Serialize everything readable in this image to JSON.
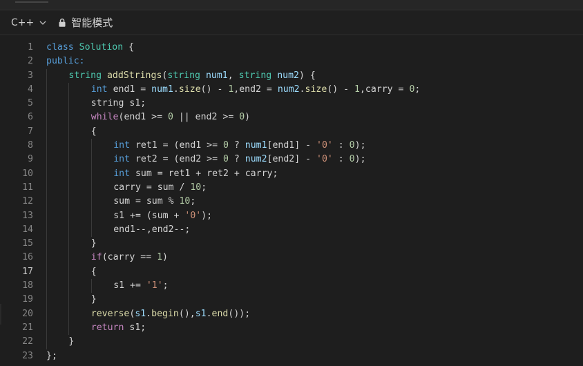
{
  "toolbar": {
    "language": "C++",
    "mode_label": "智能模式"
  },
  "colors": {
    "background": "#1e1e1e",
    "keyword": "#569cd6",
    "class": "#4ec9b0",
    "function": "#dcdcaa",
    "control": "#c586c0",
    "number": "#b5cea8",
    "string": "#ce9178",
    "text": "#d4d4d4"
  },
  "editor": {
    "active_line": 17,
    "lines": [
      {
        "n": "1",
        "indent": 0,
        "tokens": [
          [
            "kw",
            "class"
          ],
          [
            "txt",
            " "
          ],
          [
            "cls",
            "Solution"
          ],
          [
            "txt",
            " {"
          ]
        ]
      },
      {
        "n": "2",
        "indent": 0,
        "tokens": [
          [
            "kw",
            "public:"
          ]
        ]
      },
      {
        "n": "3",
        "indent": 1,
        "tokens": [
          [
            "cls",
            "string"
          ],
          [
            "txt",
            " "
          ],
          [
            "fn",
            "addStrings"
          ],
          [
            "txt",
            "("
          ],
          [
            "cls",
            "string"
          ],
          [
            "txt",
            " "
          ],
          [
            "var",
            "num1"
          ],
          [
            "txt",
            ", "
          ],
          [
            "cls",
            "string"
          ],
          [
            "txt",
            " "
          ],
          [
            "var",
            "num2"
          ],
          [
            "txt",
            ") {"
          ]
        ]
      },
      {
        "n": "4",
        "indent": 2,
        "tokens": [
          [
            "kw",
            "int"
          ],
          [
            "txt",
            " end1 = "
          ],
          [
            "var",
            "num1"
          ],
          [
            "txt",
            "."
          ],
          [
            "fn",
            "size"
          ],
          [
            "txt",
            "() - "
          ],
          [
            "num",
            "1"
          ],
          [
            "txt",
            ",end2 = "
          ],
          [
            "var",
            "num2"
          ],
          [
            "txt",
            "."
          ],
          [
            "fn",
            "size"
          ],
          [
            "txt",
            "() - "
          ],
          [
            "num",
            "1"
          ],
          [
            "txt",
            ",carry = "
          ],
          [
            "num",
            "0"
          ],
          [
            "txt",
            ";"
          ]
        ]
      },
      {
        "n": "5",
        "indent": 2,
        "tokens": [
          [
            "txt",
            "string s1;"
          ]
        ]
      },
      {
        "n": "6",
        "indent": 2,
        "tokens": [
          [
            "ctrl",
            "while"
          ],
          [
            "txt",
            "(end1 >= "
          ],
          [
            "num",
            "0"
          ],
          [
            "txt",
            " || end2 >= "
          ],
          [
            "num",
            "0"
          ],
          [
            "txt",
            ")"
          ]
        ]
      },
      {
        "n": "7",
        "indent": 2,
        "tokens": [
          [
            "txt",
            "{"
          ]
        ]
      },
      {
        "n": "8",
        "indent": 3,
        "tokens": [
          [
            "kw",
            "int"
          ],
          [
            "txt",
            " ret1 = (end1 >= "
          ],
          [
            "num",
            "0"
          ],
          [
            "txt",
            " ? "
          ],
          [
            "var",
            "num1"
          ],
          [
            "txt",
            "[end1] - "
          ],
          [
            "str",
            "'0'"
          ],
          [
            "txt",
            " : "
          ],
          [
            "num",
            "0"
          ],
          [
            "txt",
            ");"
          ]
        ]
      },
      {
        "n": "9",
        "indent": 3,
        "tokens": [
          [
            "kw",
            "int"
          ],
          [
            "txt",
            " ret2 = (end2 >= "
          ],
          [
            "num",
            "0"
          ],
          [
            "txt",
            " ? "
          ],
          [
            "var",
            "num2"
          ],
          [
            "txt",
            "[end2] - "
          ],
          [
            "str",
            "'0'"
          ],
          [
            "txt",
            " : "
          ],
          [
            "num",
            "0"
          ],
          [
            "txt",
            ");"
          ]
        ]
      },
      {
        "n": "10",
        "indent": 3,
        "tokens": [
          [
            "kw",
            "int"
          ],
          [
            "txt",
            " sum = ret1 + ret2 + carry;"
          ]
        ]
      },
      {
        "n": "11",
        "indent": 3,
        "tokens": [
          [
            "txt",
            "carry = sum / "
          ],
          [
            "num",
            "10"
          ],
          [
            "txt",
            ";"
          ]
        ]
      },
      {
        "n": "12",
        "indent": 3,
        "tokens": [
          [
            "txt",
            "sum = sum % "
          ],
          [
            "num",
            "10"
          ],
          [
            "txt",
            ";"
          ]
        ]
      },
      {
        "n": "13",
        "indent": 3,
        "tokens": [
          [
            "txt",
            "s1 += (sum + "
          ],
          [
            "str",
            "'0'"
          ],
          [
            "txt",
            ");"
          ]
        ]
      },
      {
        "n": "14",
        "indent": 3,
        "tokens": [
          [
            "txt",
            "end1--,end2--;"
          ]
        ]
      },
      {
        "n": "15",
        "indent": 2,
        "tokens": [
          [
            "txt",
            "}"
          ]
        ]
      },
      {
        "n": "16",
        "indent": 2,
        "tokens": [
          [
            "ctrl",
            "if"
          ],
          [
            "txt",
            "(carry == "
          ],
          [
            "num",
            "1"
          ],
          [
            "txt",
            ")"
          ]
        ]
      },
      {
        "n": "17",
        "indent": 2,
        "tokens": [
          [
            "txt",
            "{"
          ]
        ]
      },
      {
        "n": "18",
        "indent": 3,
        "tokens": [
          [
            "txt",
            "s1 += "
          ],
          [
            "str",
            "'1'"
          ],
          [
            "txt",
            ";"
          ]
        ]
      },
      {
        "n": "19",
        "indent": 2,
        "tokens": [
          [
            "txt",
            "}"
          ]
        ]
      },
      {
        "n": "20",
        "indent": 2,
        "tokens": [
          [
            "fn",
            "reverse"
          ],
          [
            "txt",
            "("
          ],
          [
            "var",
            "s1"
          ],
          [
            "txt",
            "."
          ],
          [
            "fn",
            "begin"
          ],
          [
            "txt",
            "(),"
          ],
          [
            "var",
            "s1"
          ],
          [
            "txt",
            "."
          ],
          [
            "fn",
            "end"
          ],
          [
            "txt",
            "());"
          ]
        ]
      },
      {
        "n": "21",
        "indent": 2,
        "tokens": [
          [
            "ctrl",
            "return"
          ],
          [
            "txt",
            " s1;"
          ]
        ]
      },
      {
        "n": "22",
        "indent": 1,
        "tokens": [
          [
            "txt",
            "}"
          ]
        ]
      },
      {
        "n": "23",
        "indent": 0,
        "tokens": [
          [
            "txt",
            "};"
          ]
        ]
      }
    ]
  }
}
